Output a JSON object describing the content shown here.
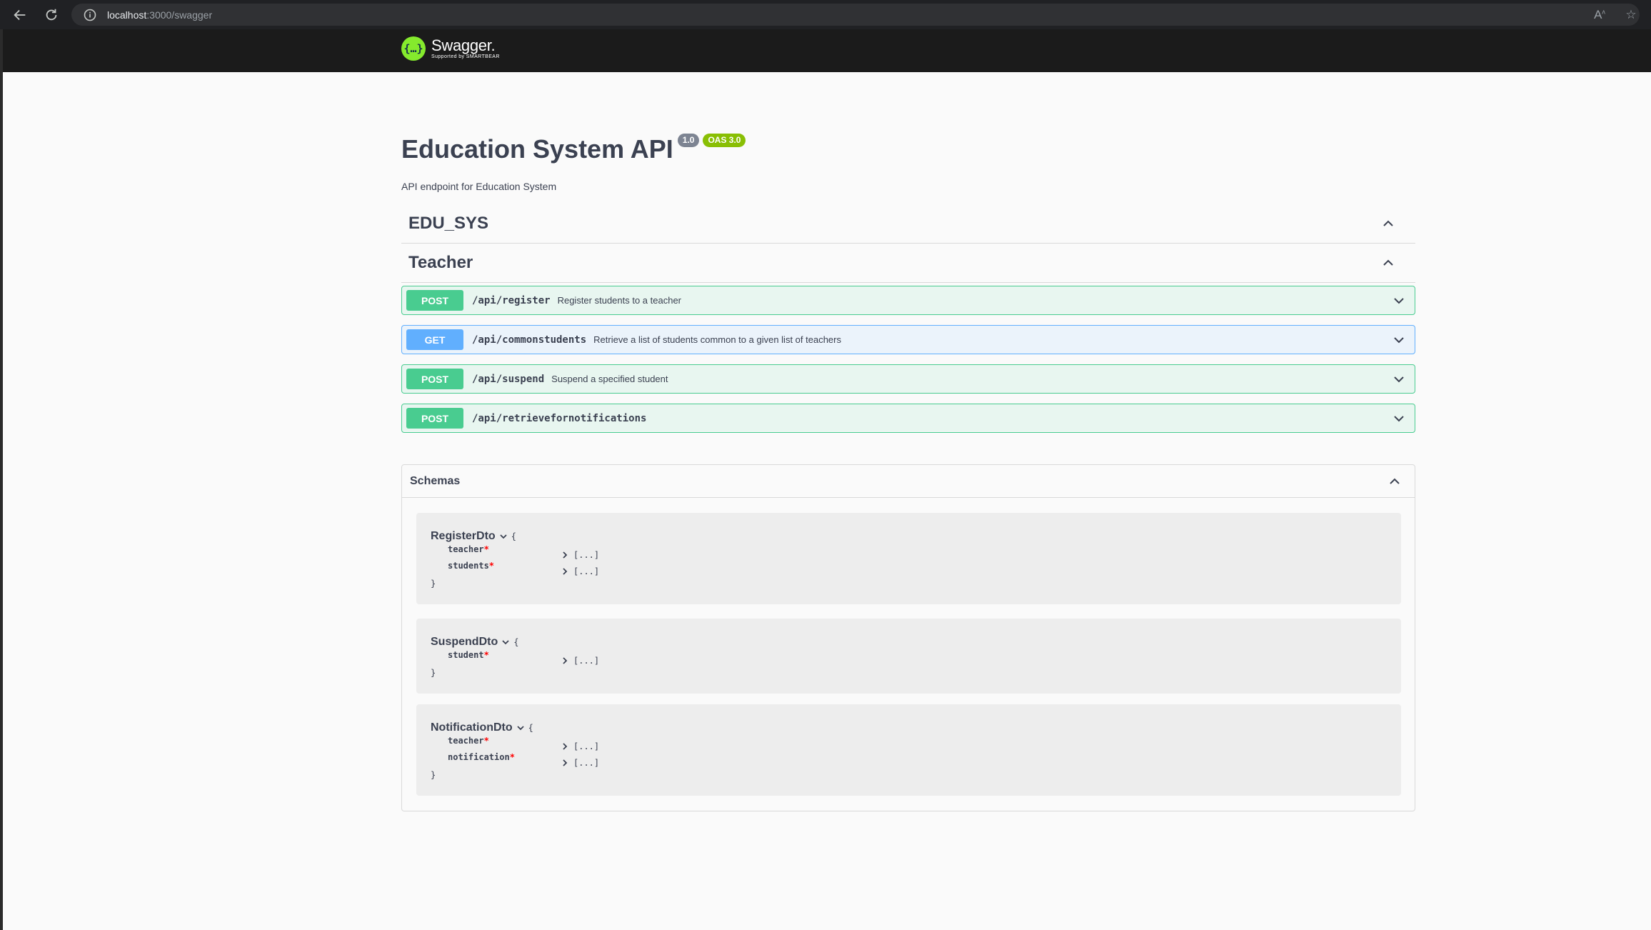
{
  "browser": {
    "url_host": "localhost",
    "url_rest": ":3000/swagger"
  },
  "swagger": {
    "logo_name": "Swagger.",
    "logo_sub": "Supported by SMARTBEAR",
    "title": "Education System API",
    "version": "1.0",
    "oas": "OAS 3.0",
    "description": "API endpoint for Education System"
  },
  "tags": [
    {
      "name": "EDU_SYS"
    },
    {
      "name": "Teacher"
    }
  ],
  "operations": [
    {
      "method": "POST",
      "path": "/api/register",
      "summary": "Register students to a teacher"
    },
    {
      "method": "GET",
      "path": "/api/commonstudents",
      "summary": "Retrieve a list of students common to a given list of teachers"
    },
    {
      "method": "POST",
      "path": "/api/suspend",
      "summary": "Suspend a specified student"
    },
    {
      "method": "POST",
      "path": "/api/retrievefornotifications",
      "summary": ""
    }
  ],
  "schemas": {
    "title": "Schemas",
    "models": [
      {
        "name": "RegisterDto",
        "props": [
          {
            "name": "teacher",
            "value": "[...]"
          },
          {
            "name": "students",
            "value": "[...]"
          }
        ]
      },
      {
        "name": "SuspendDto",
        "props": [
          {
            "name": "student",
            "value": "[...]"
          }
        ]
      },
      {
        "name": "NotificationDto",
        "props": [
          {
            "name": "teacher",
            "value": "[...]"
          },
          {
            "name": "notification",
            "value": "[...]"
          }
        ]
      }
    ],
    "open_brace": "{",
    "close_brace": "}",
    "required_mark": "*"
  },
  "colors": {
    "post": "#49cc90",
    "get": "#61affe",
    "oas_badge": "#89bf04",
    "version_badge": "#7d8492"
  }
}
